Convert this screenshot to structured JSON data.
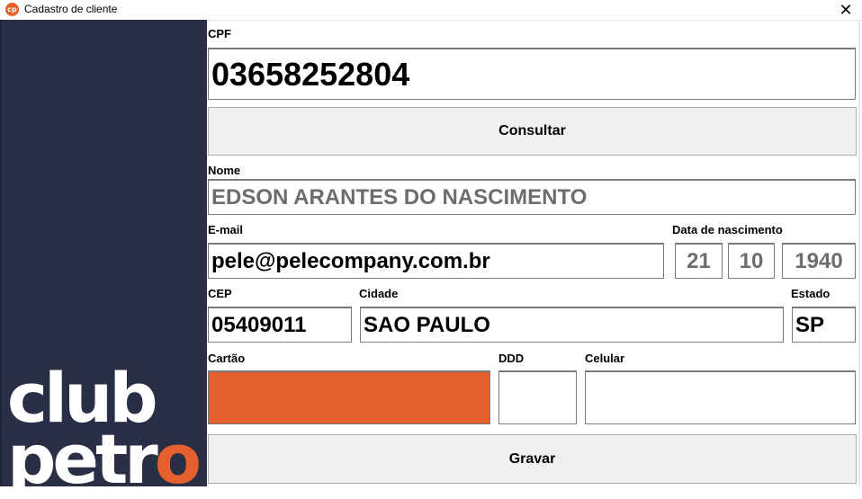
{
  "window": {
    "title": "Cadastro de cliente",
    "icon_text": "cp",
    "close_label": "✕"
  },
  "sidebar": {
    "logo_line1": "club",
    "logo_line2_prefix": "petr",
    "logo_line2_accent": "o"
  },
  "form": {
    "cpf": {
      "label": "CPF",
      "value": "03658252804"
    },
    "consultar_label": "Consultar",
    "nome": {
      "label": "Nome",
      "value": "EDSON ARANTES DO NASCIMENTO"
    },
    "email": {
      "label": "E-mail",
      "value": "pele@pelecompany.com.br"
    },
    "nascimento": {
      "label": "Data de nascimento",
      "dia": "21",
      "mes": "10",
      "ano": "1940"
    },
    "cep": {
      "label": "CEP",
      "value": "05409011"
    },
    "cidade": {
      "label": "Cidade",
      "value": "SAO PAULO"
    },
    "estado": {
      "label": "Estado",
      "value": "SP"
    },
    "cartao": {
      "label": "Cartão",
      "value": "",
      "color": "#e5602c"
    },
    "ddd": {
      "label": "DDD",
      "value": ""
    },
    "celular": {
      "label": "Celular",
      "value": ""
    },
    "gravar_label": "Gravar"
  },
  "colors": {
    "sidebar": "#2a2f45",
    "accent": "#e5602c",
    "button": "#f0f0f0"
  }
}
